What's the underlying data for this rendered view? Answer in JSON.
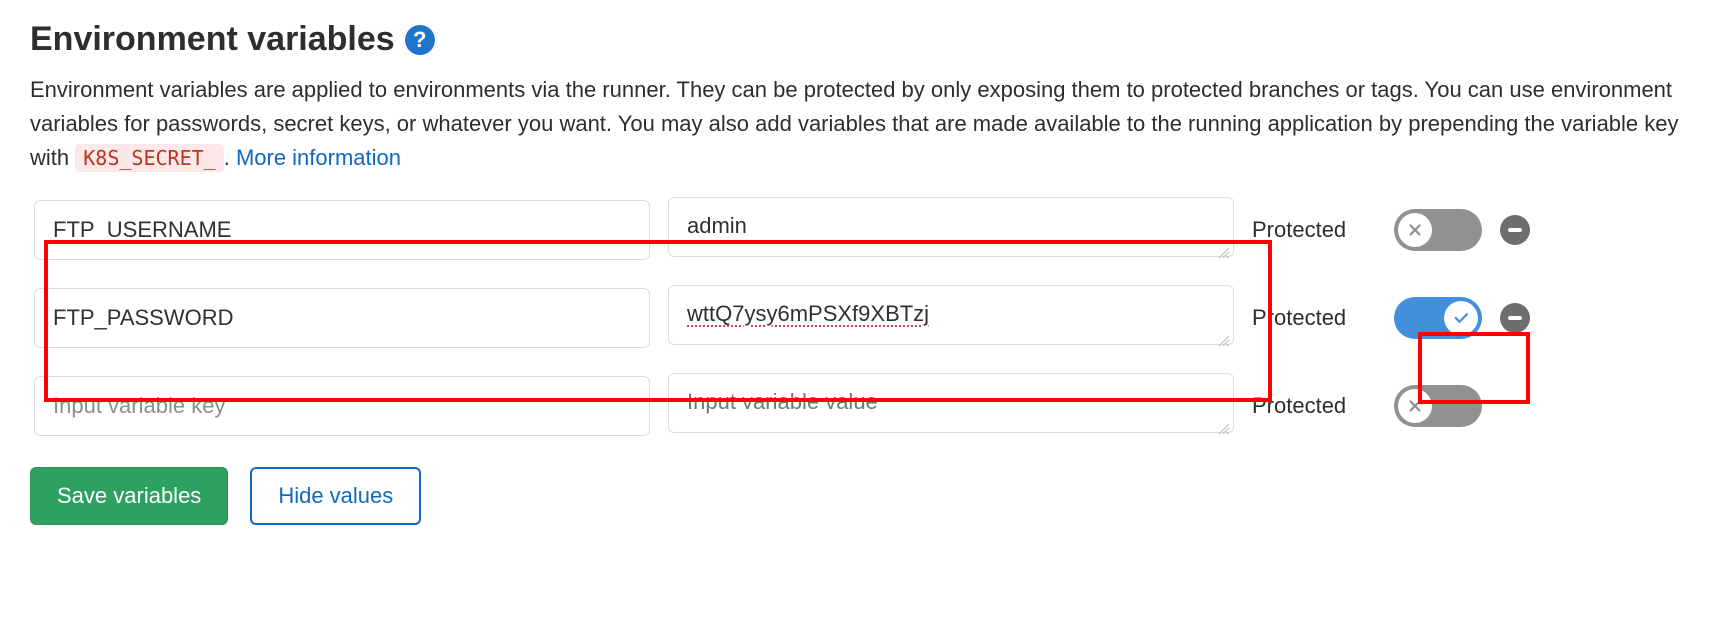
{
  "header": {
    "title": "Environment variables",
    "description_part1": "Environment variables are applied to environments via the runner. They can be protected by only exposing them to protected branches or tags. You can use environment variables for passwords, secret keys, or whatever you want. You may also add variables that are made available to the running application by prepending the variable key with ",
    "code_token": "K8S_SECRET_",
    "description_part2": ". ",
    "more_info_label": "More information"
  },
  "labels": {
    "protected": "Protected",
    "key_placeholder": "Input variable key",
    "value_placeholder": "Input variable value"
  },
  "variables": [
    {
      "key": "FTP_USERNAME",
      "value": "admin",
      "protected": false
    },
    {
      "key": "FTP_PASSWORD",
      "value": "wttQ7ysy6mPSXf9XBTzj",
      "protected": true
    },
    {
      "key": "",
      "value": "",
      "protected": false
    }
  ],
  "buttons": {
    "save": "Save variables",
    "hide": "Hide values"
  }
}
